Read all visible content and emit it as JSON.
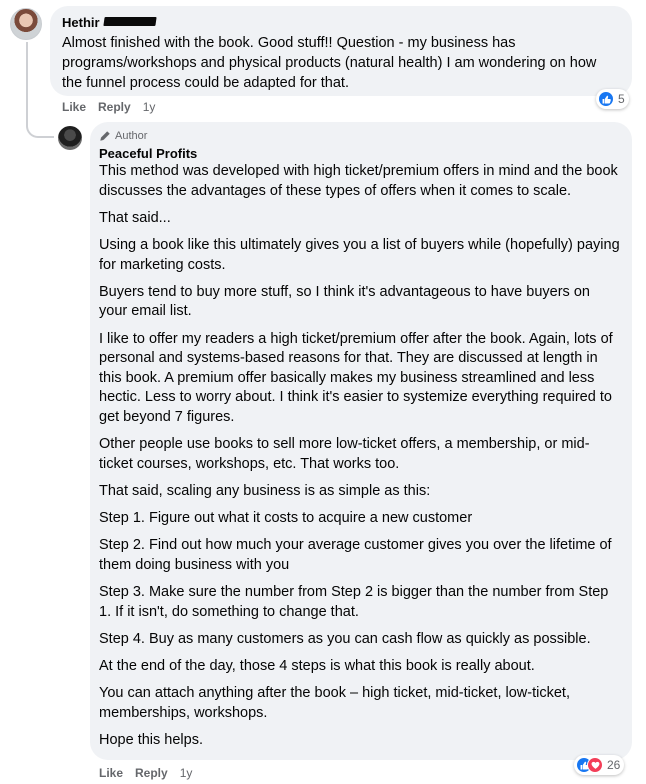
{
  "top_comment": {
    "author": "Hethir",
    "text": "Almost finished with the book. Good stuff!! Question - my business has programs/workshops and physical products (natural health) I am wondering on how the funnel process could be adapted for that.",
    "actions": {
      "like": "Like",
      "reply": "Reply",
      "time": "1y"
    },
    "reaction_count": "5",
    "reaction_icons": [
      "like-icon"
    ]
  },
  "reply_comment": {
    "badge": "Author",
    "author": "Peaceful Profits",
    "paragraphs": [
      "This method was developed with high ticket/premium offers in mind and the book discusses the advantages of these types of offers when it comes to scale.",
      "That said...",
      "Using a book like this ultimately gives you a list of buyers while (hopefully) paying for marketing costs.",
      "Buyers tend to buy more stuff, so I think it's advantageous to have buyers on your email list.",
      "I like to offer my readers a high ticket/premium offer after the book. Again, lots of personal and systems-based reasons for that. They are discussed at length in this book. A premium offer basically makes my business streamlined and less hectic. Less to worry about. I think it's easier to systemize everything required to get beyond 7 figures.",
      "Other people use books to sell more low-ticket offers, a membership, or mid-ticket courses, workshops, etc. That works too.",
      "That said, scaling any business is as simple as this:",
      "Step 1. Figure out what it costs to acquire a new customer",
      "Step 2. Find out how much your average customer gives you over the lifetime of them doing business with you",
      "Step 3. Make sure the number from Step 2 is bigger than the number from Step 1. If it isn't, do something to change that.",
      "Step 4. Buy as many customers as you can cash flow as quickly as possible.",
      "At the end of the day, those 4 steps is what this book is really about.",
      "You can attach anything after the book – high ticket, mid-ticket, low-ticket, memberships, workshops.",
      "Hope this helps."
    ],
    "actions": {
      "like": "Like",
      "reply": "Reply",
      "time": "1y"
    },
    "reaction_count": "26",
    "reaction_icons": [
      "like-icon",
      "love-icon"
    ]
  },
  "colors": {
    "bubble": "#f0f2f5",
    "like_blue": "#1877f2",
    "love_red": "#f33e58",
    "secondary_text": "#65676b"
  }
}
